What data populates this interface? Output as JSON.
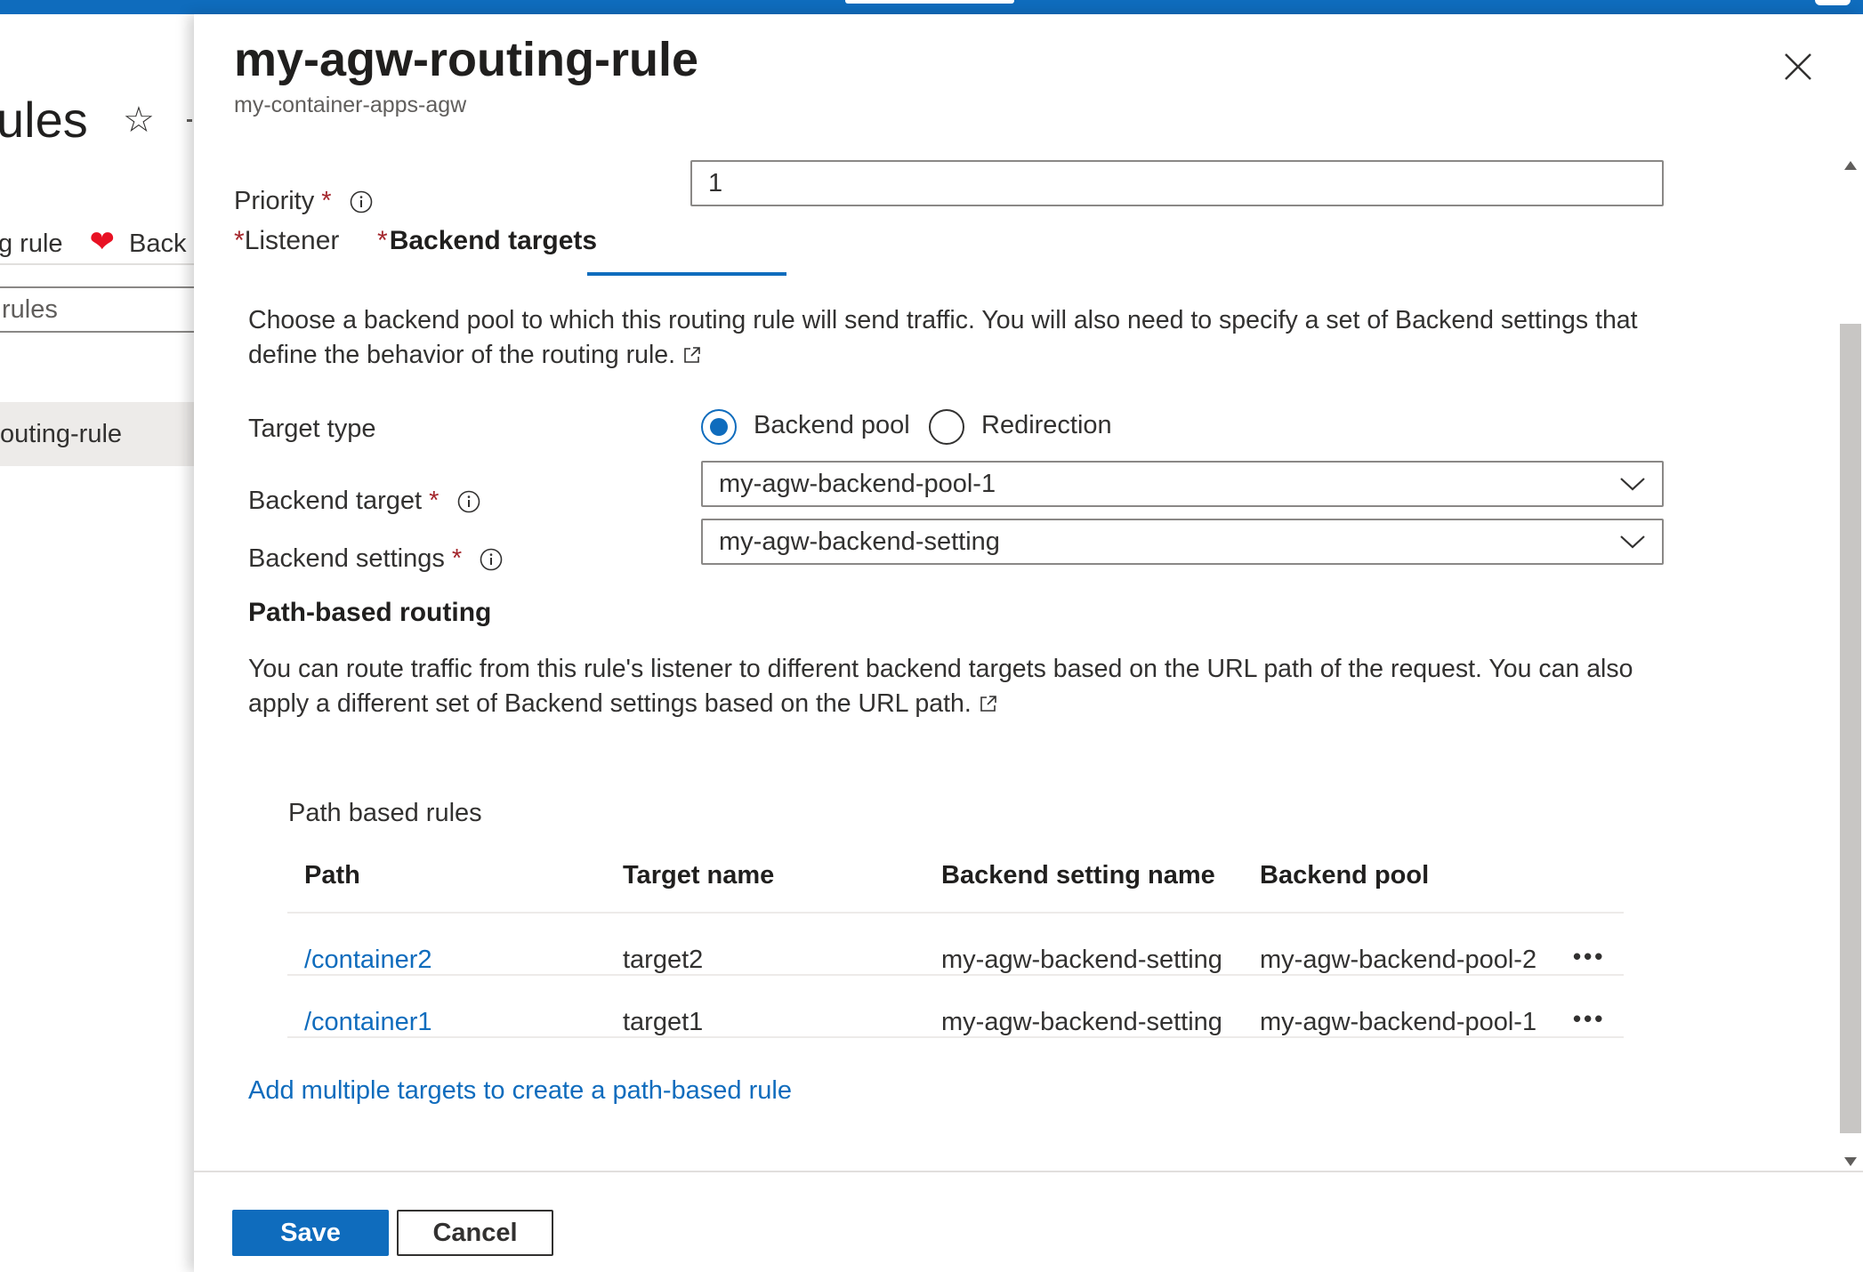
{
  "background_blade": {
    "title_fragment": "ules",
    "toolbar_fragment_1": "g rule",
    "toolbar_fragment_2": "Back",
    "search_fragment": "rules",
    "list_item_fragment": "outing-rule"
  },
  "blade": {
    "title": "my-agw-routing-rule",
    "subtitle": "my-container-apps-agw"
  },
  "form": {
    "priority": {
      "label": "Priority",
      "required_mark": "*",
      "value": "1"
    },
    "tabs": [
      {
        "label": "Listener",
        "required_mark": "*",
        "active": false
      },
      {
        "label": "Backend targets",
        "required_mark": "*",
        "active": true
      }
    ],
    "backend_description": "Choose a backend pool to which this routing rule will send traffic. You will also need to specify a set of Backend settings that define the behavior of the routing rule.",
    "target_type": {
      "label": "Target type",
      "options": [
        {
          "label": "Backend pool",
          "selected": true
        },
        {
          "label": "Redirection",
          "selected": false
        }
      ]
    },
    "backend_target": {
      "label": "Backend target",
      "required_mark": "*",
      "value": "my-agw-backend-pool-1"
    },
    "backend_settings": {
      "label": "Backend settings",
      "required_mark": "*",
      "value": "my-agw-backend-setting"
    }
  },
  "path_routing": {
    "heading": "Path-based routing",
    "description": "You can route traffic from this rule's listener to different backend targets based on the URL path of the request. You can also apply a different set of Backend settings based on the URL path.",
    "table_caption": "Path based rules",
    "columns": [
      "Path",
      "Target name",
      "Backend setting name",
      "Backend pool"
    ],
    "rows": [
      {
        "path": "/container2",
        "target_name": "target2",
        "backend_setting": "my-agw-backend-setting",
        "backend_pool": "my-agw-backend-pool-2",
        "more": "•••"
      },
      {
        "path": "/container1",
        "target_name": "target1",
        "backend_setting": "my-agw-backend-setting",
        "backend_pool": "my-agw-backend-pool-1",
        "more": "•••"
      }
    ],
    "add_link": "Add multiple targets to create a path-based rule"
  },
  "footer": {
    "save_label": "Save",
    "cancel_label": "Cancel"
  },
  "colors": {
    "accent": "#0f6cbd",
    "required": "#a4262c",
    "heart": "#e81123"
  }
}
